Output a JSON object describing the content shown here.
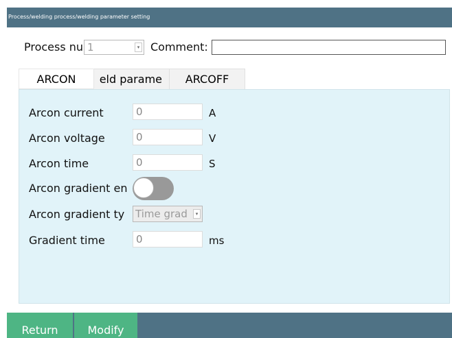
{
  "window": {
    "title": "Process/welding process/welding parameter setting"
  },
  "header": {
    "process_label": "Process nu",
    "process_value": "1",
    "comment_label": "Comment:",
    "comment_value": ""
  },
  "tabs": [
    {
      "label": "ARCON",
      "active": true
    },
    {
      "label": "eld parame",
      "active": false
    },
    {
      "label": "ARCOFF",
      "active": false
    }
  ],
  "form": {
    "arcon_current": {
      "label": "Arcon current",
      "value": "0",
      "unit": "A"
    },
    "arcon_voltage": {
      "label": "Arcon voltage",
      "value": "0",
      "unit": "V"
    },
    "arcon_time": {
      "label": "Arcon time",
      "value": "0",
      "unit": "S"
    },
    "gradient_enable": {
      "label": "Arcon gradient en",
      "on": false
    },
    "gradient_type": {
      "label": "Arcon gradient ty",
      "value": "Time grad"
    },
    "gradient_time": {
      "label": "Gradient time",
      "value": "0",
      "unit": "ms"
    }
  },
  "footer": {
    "return_label": "Return",
    "modify_label": "Modify"
  },
  "colors": {
    "titlebar": "#4f7285",
    "panel": "#e1f3f9",
    "button": "#4eb584",
    "toggle_off": "#999999"
  },
  "icons": {
    "dropdown": "chevron-down-icon"
  }
}
